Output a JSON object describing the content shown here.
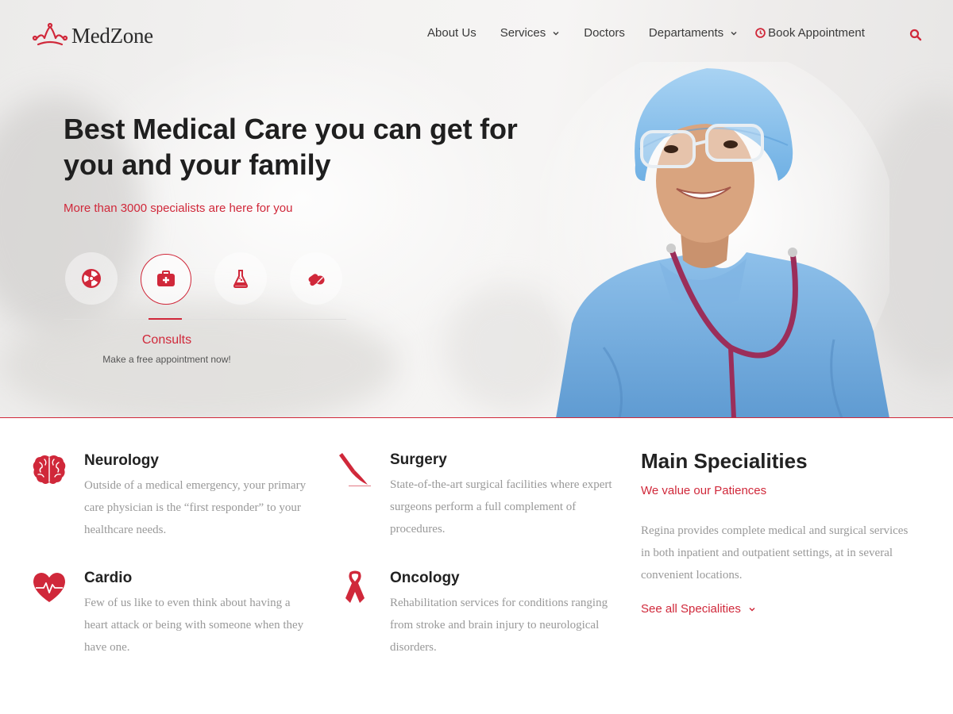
{
  "brand": {
    "name": "MedZone",
    "accent": "#d0283a"
  },
  "nav": {
    "items": [
      {
        "label": "About Us",
        "dropdown": false
      },
      {
        "label": "Services",
        "dropdown": true
      },
      {
        "label": "Doctors",
        "dropdown": false
      },
      {
        "label": "Departaments",
        "dropdown": true
      }
    ],
    "book_label": "Book Appointment",
    "search_icon": "search-icon"
  },
  "hero": {
    "title": "Best Medical Care you can get for you and your family",
    "subtitle": "More than 3000 specialists are here for you",
    "icons": [
      "radiation-icon",
      "first-aid-kit-icon",
      "flask-icon",
      "pills-icon"
    ],
    "active_icon_index": 1,
    "active_title": "Consults",
    "active_desc": "Make a free appointment now!"
  },
  "features": [
    {
      "title": "Neurology",
      "icon": "brain-icon",
      "desc": "Outside of a medical emergency, your primary care physician is the “first responder” to your healthcare needs."
    },
    {
      "title": "Surgery",
      "icon": "scalpel-icon",
      "desc": "State-of-the-art surgical facilities where expert surgeons perform a full complement of procedures."
    },
    {
      "title": "Cardio",
      "icon": "heart-pulse-icon",
      "desc": "Few of us like to even think about having a heart attack or being with someone when they have one."
    },
    {
      "title": "Oncology",
      "icon": "ribbon-icon",
      "desc": "Rehabilitation services for conditions ranging from stroke and brain injury to neurological disorders."
    }
  ],
  "main_specialities": {
    "title": "Main Specialities",
    "subtitle": "We value our Patiences",
    "desc": "Regina provides complete medical and surgical services in both inpatient and outpatient settings, at in several convenient locations.",
    "link": "See all Specialities"
  }
}
